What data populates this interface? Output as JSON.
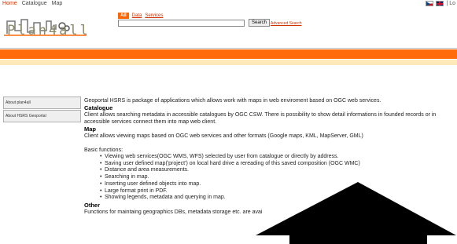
{
  "topbar": {
    "nav": [
      "Home",
      "Catalogue",
      "Map"
    ],
    "right_text": "| Lo"
  },
  "logo": {
    "text": "Plan4all"
  },
  "search": {
    "tabs": [
      "All",
      "Data",
      "Services"
    ],
    "value": "",
    "button_label": "Search",
    "advanced_label": "Advanced Search"
  },
  "sidebar": {
    "items": [
      "About plan4all",
      "About HSRS Geoportal"
    ]
  },
  "content": {
    "intro": "Geoportal HSRS is package of applications which allows work with maps in web enviroment based on OGC web services.",
    "catalogue_heading": "Catalogue",
    "catalogue_text": "Client allows searching metadata in accessible catalogues by OGC CSW. There is possibility to show detail informations in founded records or in accessible services connect them into map web client.",
    "map_heading": "Map",
    "map_text": "Client allows viewing maps based on OGC web services and other formats (Google maps, KML, MapServer, GML)",
    "basic_label": "Basic functions:",
    "functions": [
      "Viewing web services(OGC WMS, WFS) selected by user from catalogue or directly by address.",
      "Saving user defined map('project') on local hard drive a rereading of this saved composition (OGC WMC)",
      "Distance and area measurements.",
      "Searching in map.",
      "Inserting user defined objects into map.",
      "Large format print in PDF.",
      "Showing legends, metadata and querying in map."
    ],
    "other_heading": "Other",
    "other_text": "Functions for maintaing geographics DBs, metadata storage etc. are avai"
  },
  "colors": {
    "accent": "#ff6a0a",
    "link": "#cc3300",
    "sub_bar": "#fde9b9"
  }
}
